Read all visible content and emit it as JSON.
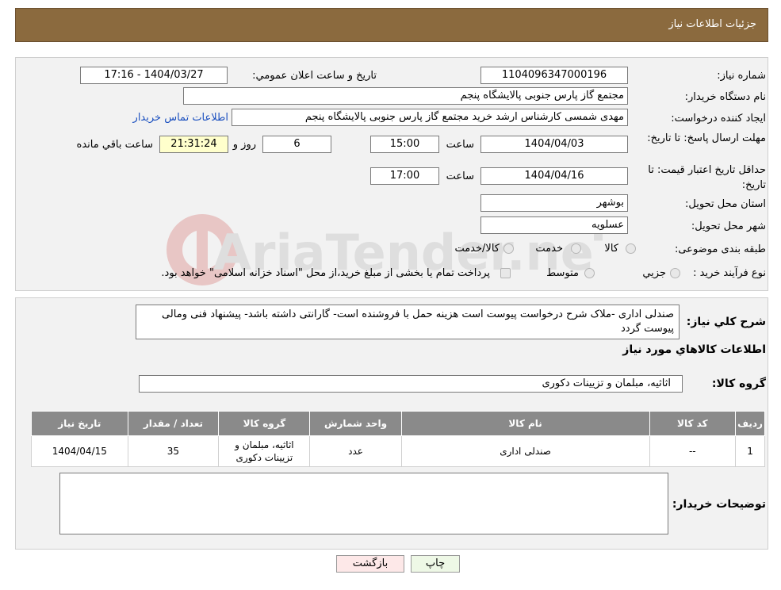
{
  "header": {
    "title": "جزئیات اطلاعات نیاز"
  },
  "labels": {
    "need_number": "شماره نیاز:",
    "announce_datetime": "تاریخ و ساعت اعلان عمومي:",
    "buyer_org": "نام دستگاه خریدار:",
    "requester": "ایجاد کننده درخواست:",
    "contact_link": "اطلاعات تماس خریدار",
    "reply_deadline": "مهلت ارسال پاسخ: تا تاریخ:",
    "time": "ساعت",
    "days_and": "روز و",
    "time_left": "ساعت باقي مانده",
    "price_validity": "حداقل تاریخ اعتبار قیمت: تا تاریخ:",
    "province": "استان محل تحویل:",
    "city": "شهر محل تحویل:",
    "category": "طبقه بندی موضوعی:",
    "process_type": "نوع فرآیند خرید :",
    "payment_note": "پرداخت تمام یا بخشی از مبلغ خرید،از محل \"اسناد خزانه اسلامی\" خواهد بود.",
    "description_title": "شرح كلي نياز:",
    "goods_info_title": "اطلاعات كالاهاي مورد نياز",
    "goods_group": "گروه كالا:",
    "buyer_notes": "توضیحات خریدار:"
  },
  "values": {
    "need_number": "1104096347000196",
    "announce_datetime": "1404/03/27 - 17:16",
    "buyer_org": "مجتمع گاز پارس جنوبی  پالایشگاه پنجم",
    "requester": "مهدی شمسی کارشناس ارشد خرید مجتمع گاز پارس جنوبی  پالایشگاه پنجم",
    "reply_date": "1404/04/03",
    "reply_time": "15:00",
    "days": "6",
    "remaining": "21:31:24",
    "validity_date": "1404/04/16",
    "validity_time": "17:00",
    "province": "بوشهر",
    "city": "عسلویه",
    "description": "صندلی اداری -ملاک شرح درخواست پیوست است هزینه حمل با فروشنده است- گارانتی داشته باشد- پیشنهاد فنی ومالی پیوست گردد",
    "goods_group": "اثاثیه، مبلمان و تزیینات دکوری",
    "buyer_notes": ""
  },
  "category_options": [
    "کالا",
    "خدمت",
    "کالا/خدمت"
  ],
  "process_options": [
    "جزیي",
    "متوسط"
  ],
  "table": {
    "headers": [
      "ردیف",
      "کد کالا",
      "نام کالا",
      "واحد شمارش",
      "گروه کالا",
      "تعداد / مقدار",
      "تاریخ نیاز"
    ],
    "rows": [
      [
        "1",
        "--",
        "صندلی اداری",
        "عدد",
        "اثاثیه، مبلمان و تزیینات دکوری",
        "35",
        "1404/04/15"
      ]
    ]
  },
  "buttons": {
    "print": "چاپ",
    "back": "بازگشت"
  },
  "watermark": {
    "text": "AriaTender.neT"
  },
  "colors": {
    "header_bg": "#8b6a3e",
    "table_header_bg": "#8a8a8a",
    "link": "#1a4fbf"
  }
}
